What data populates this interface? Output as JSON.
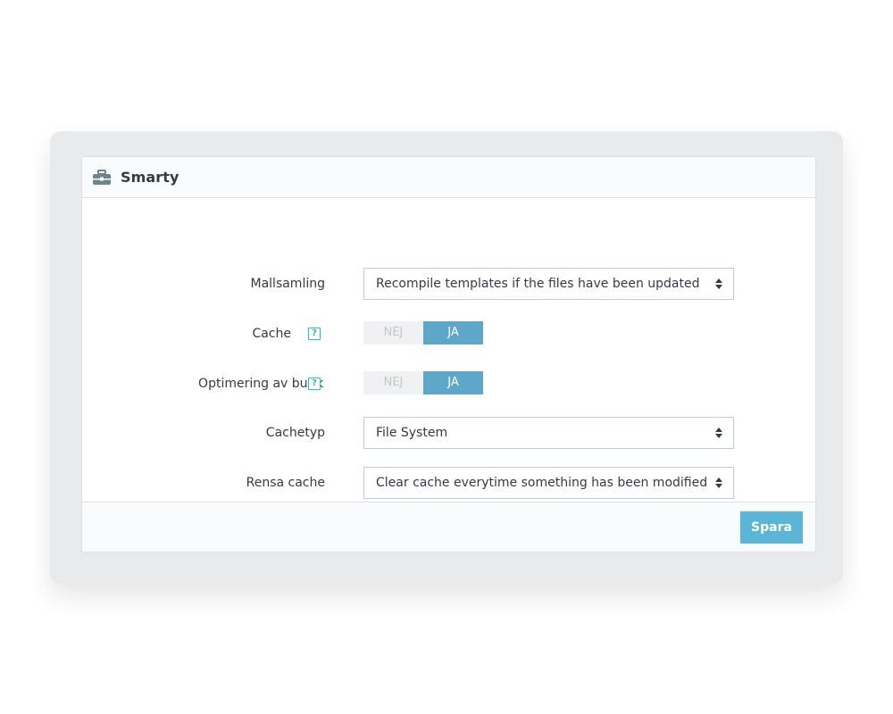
{
  "panel": {
    "icon": "toolbox-icon",
    "title": "Smarty"
  },
  "form": {
    "template_compilation": {
      "label": "Mallsamling",
      "value": "Recompile templates if the files have been updated"
    },
    "cache": {
      "label": "Cache",
      "off_label": "NEJ",
      "on_label": "JA",
      "selected": "JA"
    },
    "shop_optimization": {
      "label": "Optimering av butik",
      "off_label": "NEJ",
      "on_label": "JA",
      "selected": "JA"
    },
    "cache_type": {
      "label": "Cachetyp",
      "value": "File System"
    },
    "clear_cache": {
      "label": "Rensa cache",
      "value": "Clear cache everytime something has been modified"
    },
    "help_glyph": "?"
  },
  "footer": {
    "save_label": "Spara"
  },
  "colors": {
    "toggle_on": "#5ea7c9",
    "toggle_off": "#eff1f2",
    "help_accent": "#25b9d7",
    "save_button": "#5ab5d6"
  }
}
